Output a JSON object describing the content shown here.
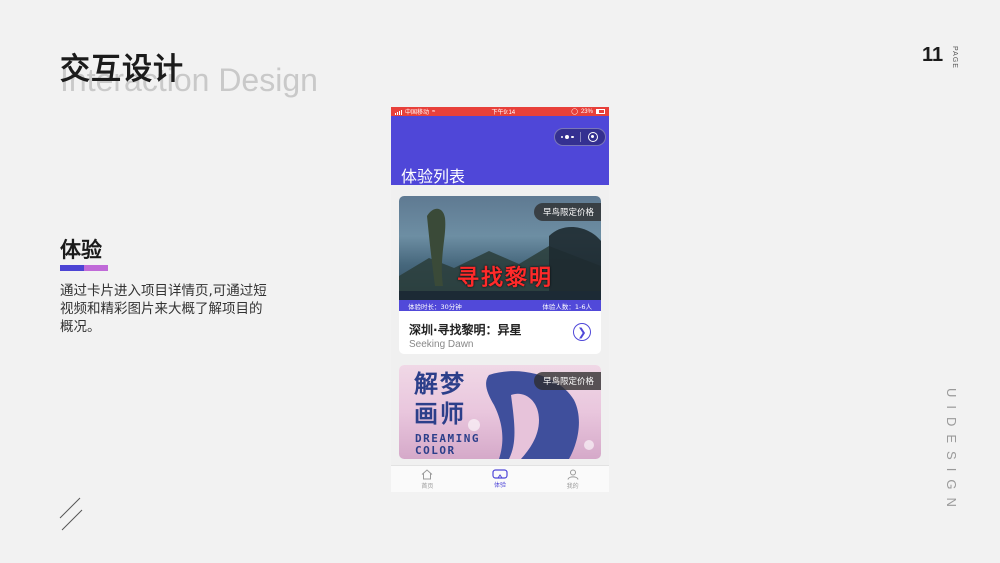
{
  "heading": {
    "cn": "交互设计",
    "en": "Interaction Design"
  },
  "page": {
    "number": "11",
    "label": "PAGE"
  },
  "side_text": "UIDESIGN",
  "section": {
    "title": "体验",
    "description": "通过卡片进入项目详情页,可通过短视频和精彩图片来大概了解项目的概况。"
  },
  "colors": {
    "accent": "#4f47d8",
    "accent2": "#c06ad8",
    "statusbar": "#e8403a",
    "price_badge": "#2d2d2d"
  },
  "phone": {
    "statusbar": {
      "carrier": "中国移动",
      "time": "下午9:14",
      "battery": "23%"
    },
    "header": {
      "title": "体验列表",
      "menu_icon": "more-dots-icon",
      "close_icon": "target-icon"
    },
    "cards": [
      {
        "badge": "早鸟限定价格",
        "poster_text": "寻找黎明",
        "duration": "体验时长：30分钟",
        "players": "体验人数：1-6人",
        "title": "深圳·寻找黎明：异星",
        "subtitle": "Seeking Dawn"
      },
      {
        "badge": "早鸟限定价格",
        "poster_title_line1": "解梦",
        "poster_title_line2": "画师",
        "poster_en_line1": "DREAMING",
        "poster_en_line2": "COLOR"
      }
    ],
    "tabs": [
      {
        "label": "首页",
        "icon": "home-icon",
        "active": false
      },
      {
        "label": "体验",
        "icon": "vr-headset-icon",
        "active": true
      },
      {
        "label": "我的",
        "icon": "user-icon",
        "active": false
      }
    ]
  }
}
